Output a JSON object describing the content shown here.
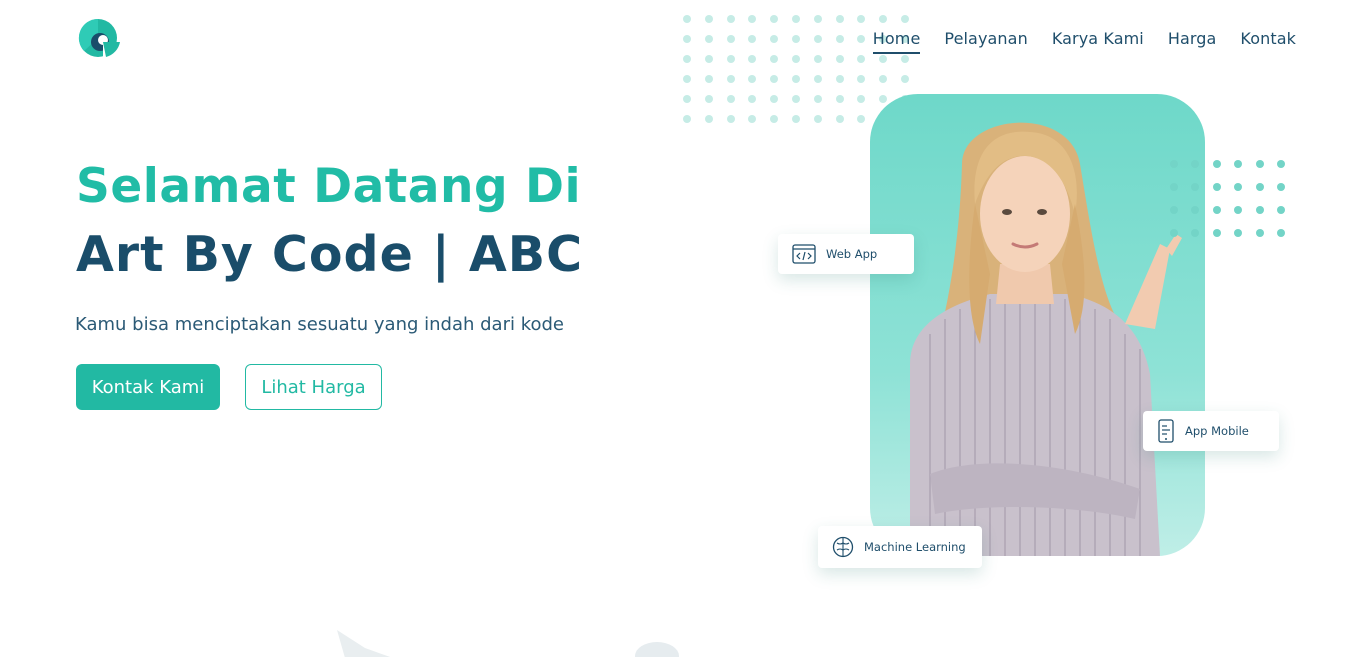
{
  "brand": {
    "logo_icon": "abc-logo-icon",
    "accent": "#22b9a3",
    "dark": "#1a4d6a"
  },
  "nav": {
    "items": [
      {
        "label": "Home",
        "active": true
      },
      {
        "label": "Pelayanan",
        "active": false
      },
      {
        "label": "Karya Kami",
        "active": false
      },
      {
        "label": "Harga",
        "active": false
      },
      {
        "label": "Kontak",
        "active": false
      }
    ]
  },
  "hero": {
    "title_line1": "Selamat Datang Di",
    "title_line2": "Art By Code | ABC",
    "subtitle": "Kamu bisa menciptakan sesuatu yang indah dari kode",
    "primary_button": "Kontak Kami",
    "secondary_button": "Lihat Harga"
  },
  "floating_cards": {
    "web": {
      "label": "Web App",
      "icon": "browser-code-icon"
    },
    "mobile": {
      "label": "App Mobile",
      "icon": "mobile-phone-icon"
    },
    "ml": {
      "label": "Machine Learning",
      "icon": "brain-icon"
    }
  }
}
